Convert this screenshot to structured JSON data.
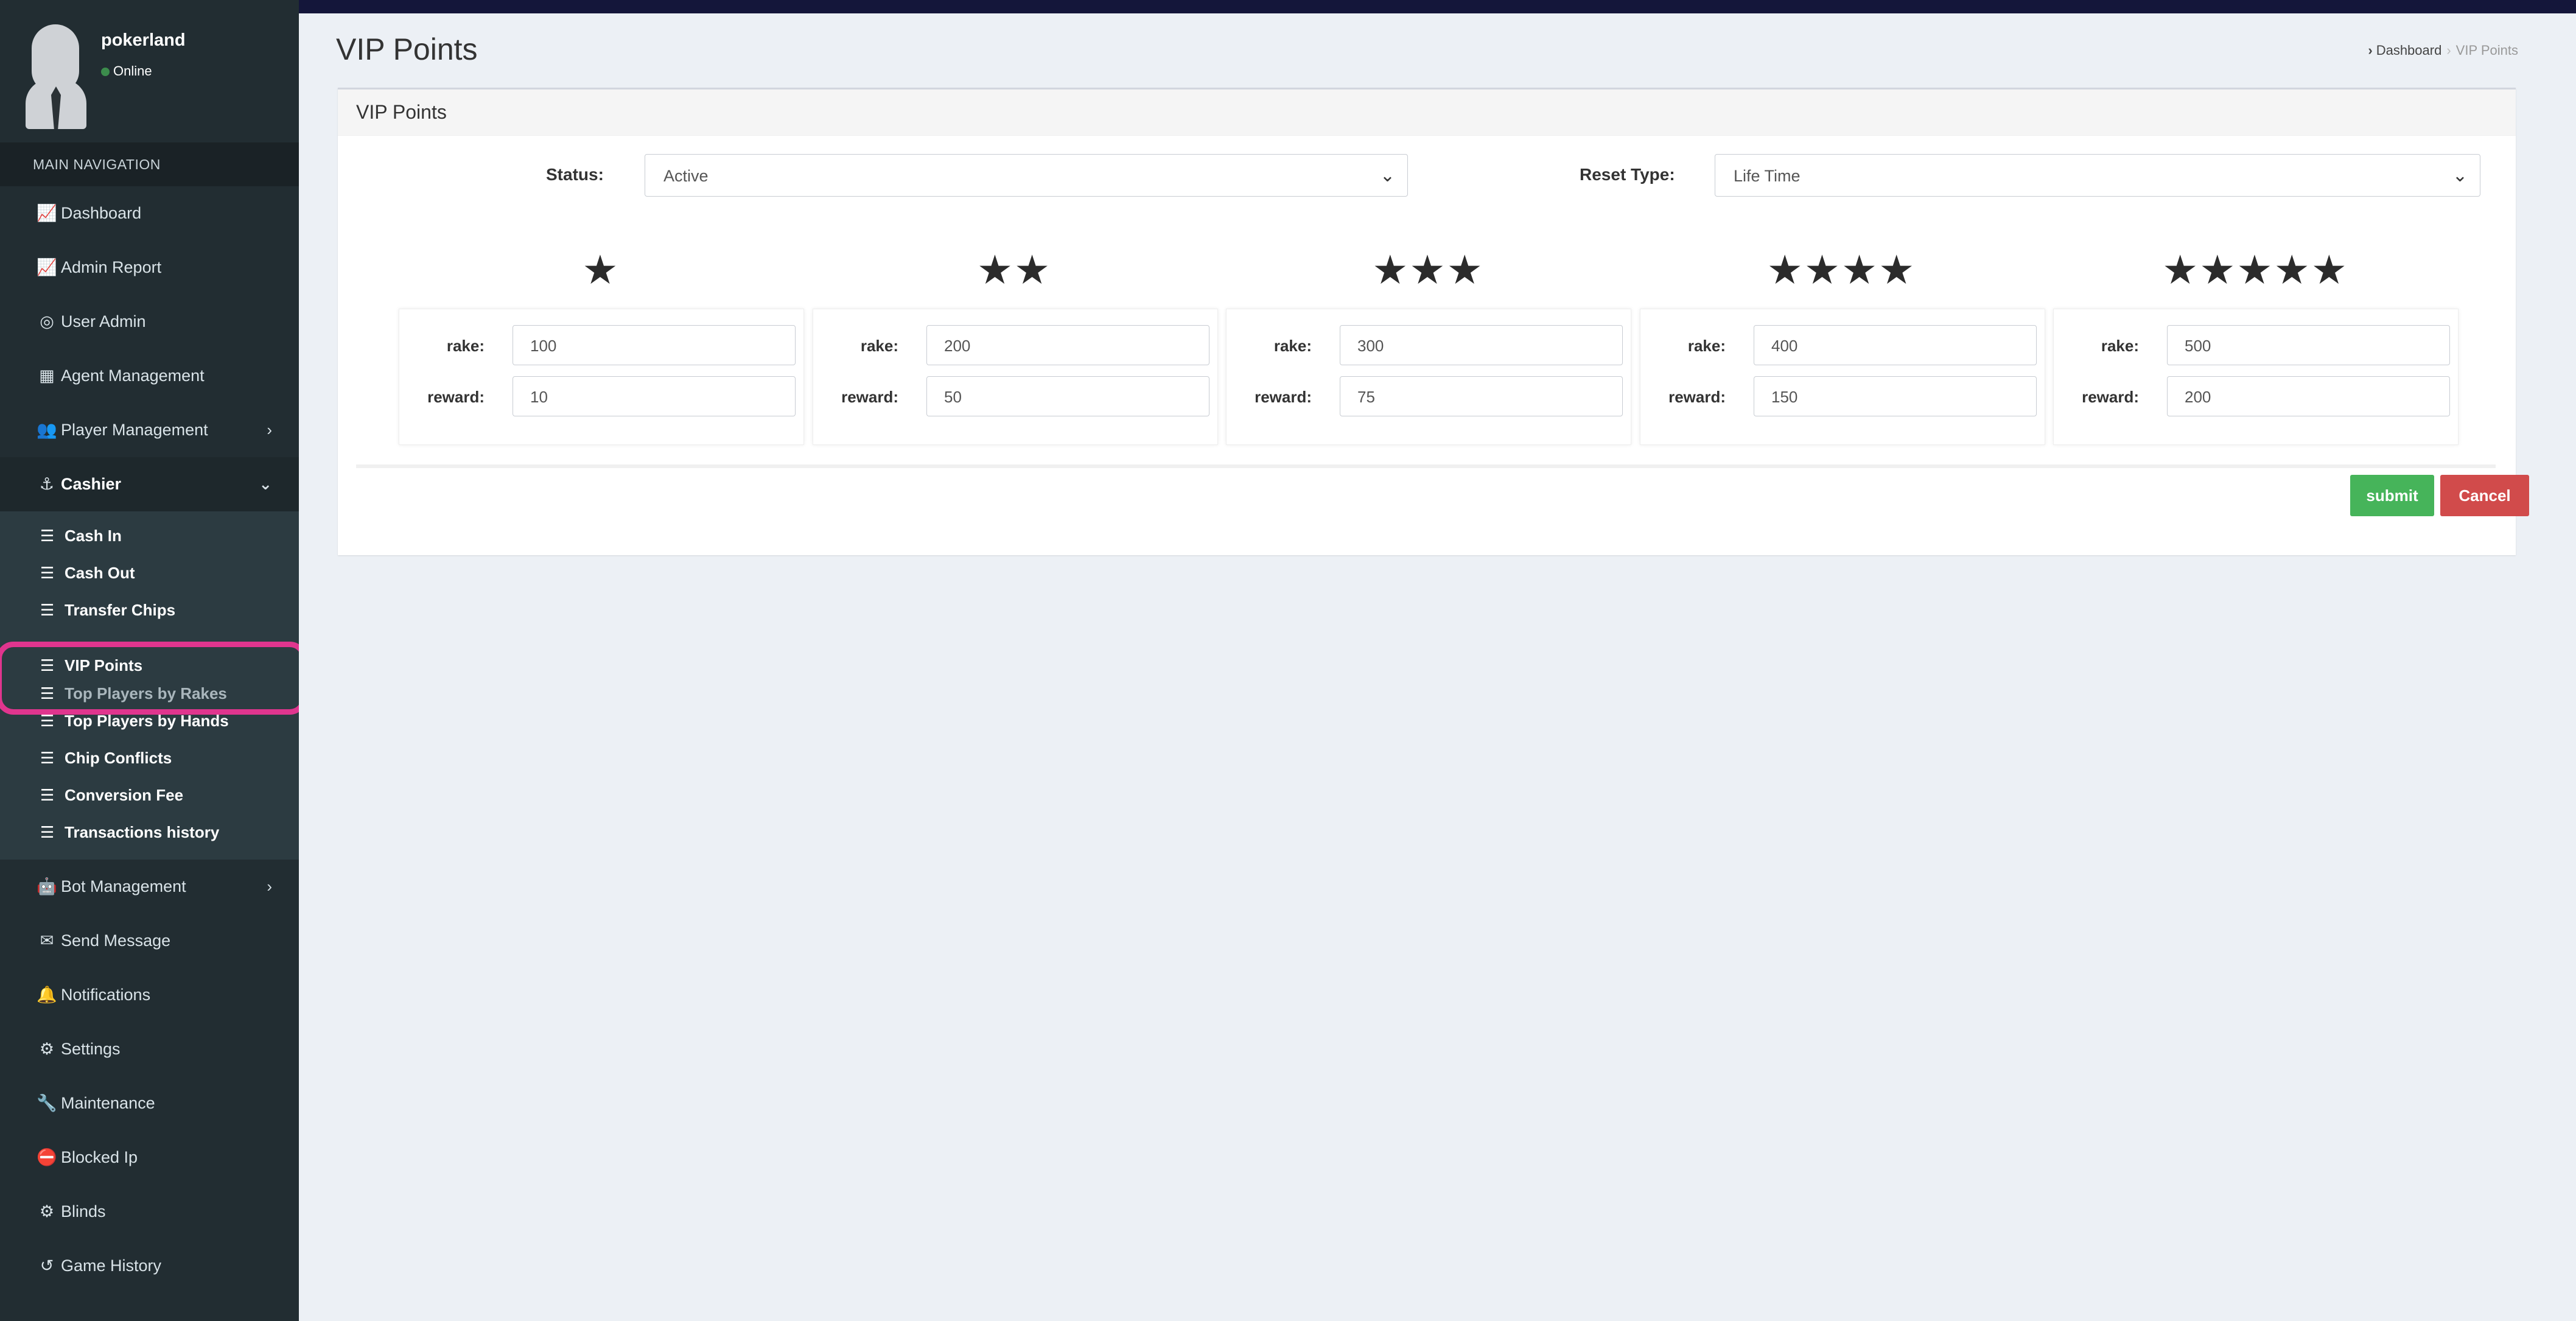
{
  "app": {
    "page_title": "VIP Points",
    "breadcrumb": {
      "parent": "Dashboard",
      "current": "VIP Points"
    }
  },
  "user": {
    "name": "pokerland",
    "status": "Online"
  },
  "sidebar": {
    "header": "MAIN NAVIGATION",
    "items": [
      {
        "label": "Dashboard",
        "icon": "chart-line-icon"
      },
      {
        "label": "Admin Report",
        "icon": "chart-line-icon"
      },
      {
        "label": "User Admin",
        "icon": "user-circle-icon"
      },
      {
        "label": "Agent Management",
        "icon": "building-icon"
      },
      {
        "label": "Player Management",
        "icon": "users-icon"
      },
      {
        "label": "Cashier",
        "icon": "cashier-icon"
      }
    ],
    "cashier_submenu": [
      "Cash In",
      "Cash Out",
      "Transfer Chips",
      "VIP Points",
      "Top Players by Rakes",
      "Top Players by Hands",
      "Chip Conflicts",
      "Conversion Fee",
      "Transactions history"
    ],
    "items_after": [
      {
        "label": "Bot Management",
        "icon": "robot-icon"
      },
      {
        "label": "Send Message",
        "icon": "envelope-icon"
      },
      {
        "label": "Notifications",
        "icon": "bell-icon"
      },
      {
        "label": "Settings",
        "icon": "gear-icon"
      },
      {
        "label": "Maintenance",
        "icon": "wrench-icon"
      },
      {
        "label": "Blocked Ip",
        "icon": "blocked-user-icon"
      },
      {
        "label": "Blinds",
        "icon": "blinds-icon"
      },
      {
        "label": "Game History",
        "icon": "history-icon"
      }
    ]
  },
  "form": {
    "box_title": "VIP Points",
    "status_label": "Status:",
    "status_value": "Active",
    "reset_label": "Reset Type:",
    "reset_value": "Life Time",
    "rake_label": "rake:",
    "reward_label": "reward:",
    "tiers": [
      {
        "stars": 1,
        "rake": "100",
        "reward": "10"
      },
      {
        "stars": 2,
        "rake": "200",
        "reward": "50"
      },
      {
        "stars": 3,
        "rake": "300",
        "reward": "75"
      },
      {
        "stars": 4,
        "rake": "400",
        "reward": "150"
      },
      {
        "stars": 5,
        "rake": "500",
        "reward": "200"
      }
    ],
    "submit_label": "submit",
    "cancel_label": "Cancel"
  },
  "colors": {
    "sidebar_bg": "#222d32",
    "main_bg": "#ecf0f5",
    "submit_green": "#46b45a",
    "cancel_red": "#d14b4b",
    "highlight_pink": "#e0358e"
  }
}
